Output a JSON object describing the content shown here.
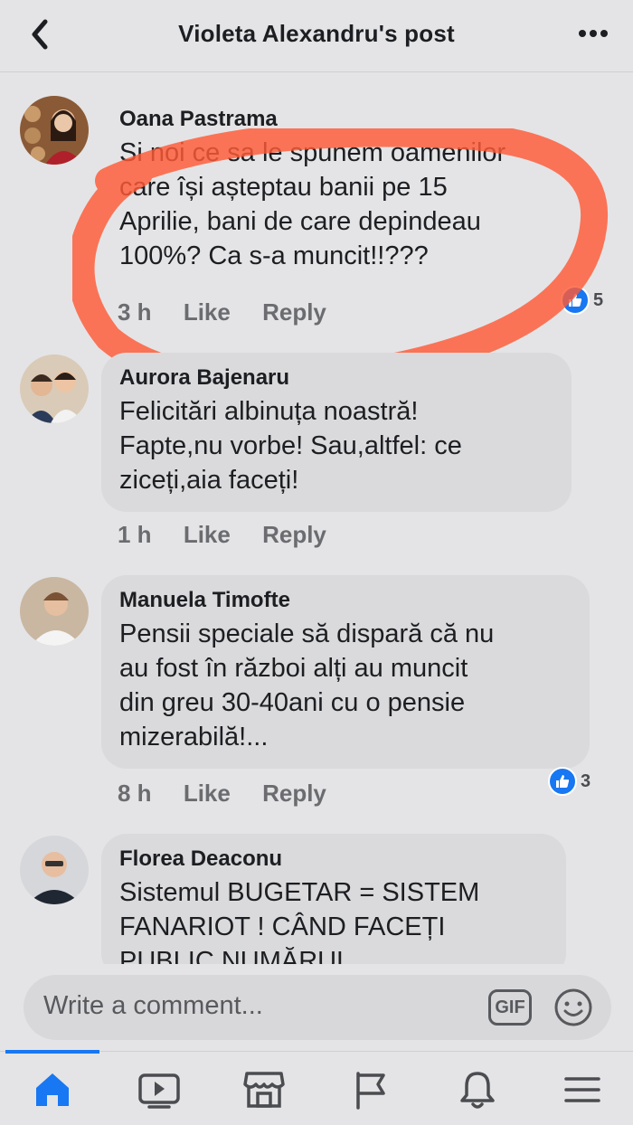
{
  "header": {
    "title": "Violeta Alexandru's post"
  },
  "comments": [
    {
      "author": "Oana Pastrama",
      "text": "Si noi ce sa le spunem oamenilor\ncare își așteptau banii pe 15\nAprilie, bani de care depindeau\n100%? Ca s-a muncit!!???",
      "time": "3 h",
      "like": "Like",
      "reply": "Reply",
      "reactions": "5"
    },
    {
      "author": "Aurora Bajenaru",
      "text": "Felicitări albinuța noastră!\nFapte,nu vorbe! Sau,altfel: ce\nziceți,aia faceți!",
      "time": "1 h",
      "like": "Like",
      "reply": "Reply"
    },
    {
      "author": "Manuela Timofte",
      "text": "Pensii speciale să dispară că nu\nau fost în război alți au muncit\ndin greu 30-40ani cu o pensie\nmizerabilă!...",
      "time": "8 h",
      "like": "Like",
      "reply": "Reply",
      "reactions": "3"
    },
    {
      "author": "Florea Deaconu",
      "text": "Sistemul BUGETAR  = SISTEM\nFANARIOT !  CÂND FACEȚI\nPUBLIC NUMĂRUL"
    }
  ],
  "composer": {
    "placeholder": "Write a comment...",
    "gif": "GIF"
  },
  "colors": {
    "accent": "#1877f2",
    "highlight": "#ff5a36"
  },
  "tabs": [
    "home-icon",
    "video-icon",
    "marketplace-icon",
    "flag-icon",
    "bell-icon",
    "menu-icon"
  ]
}
